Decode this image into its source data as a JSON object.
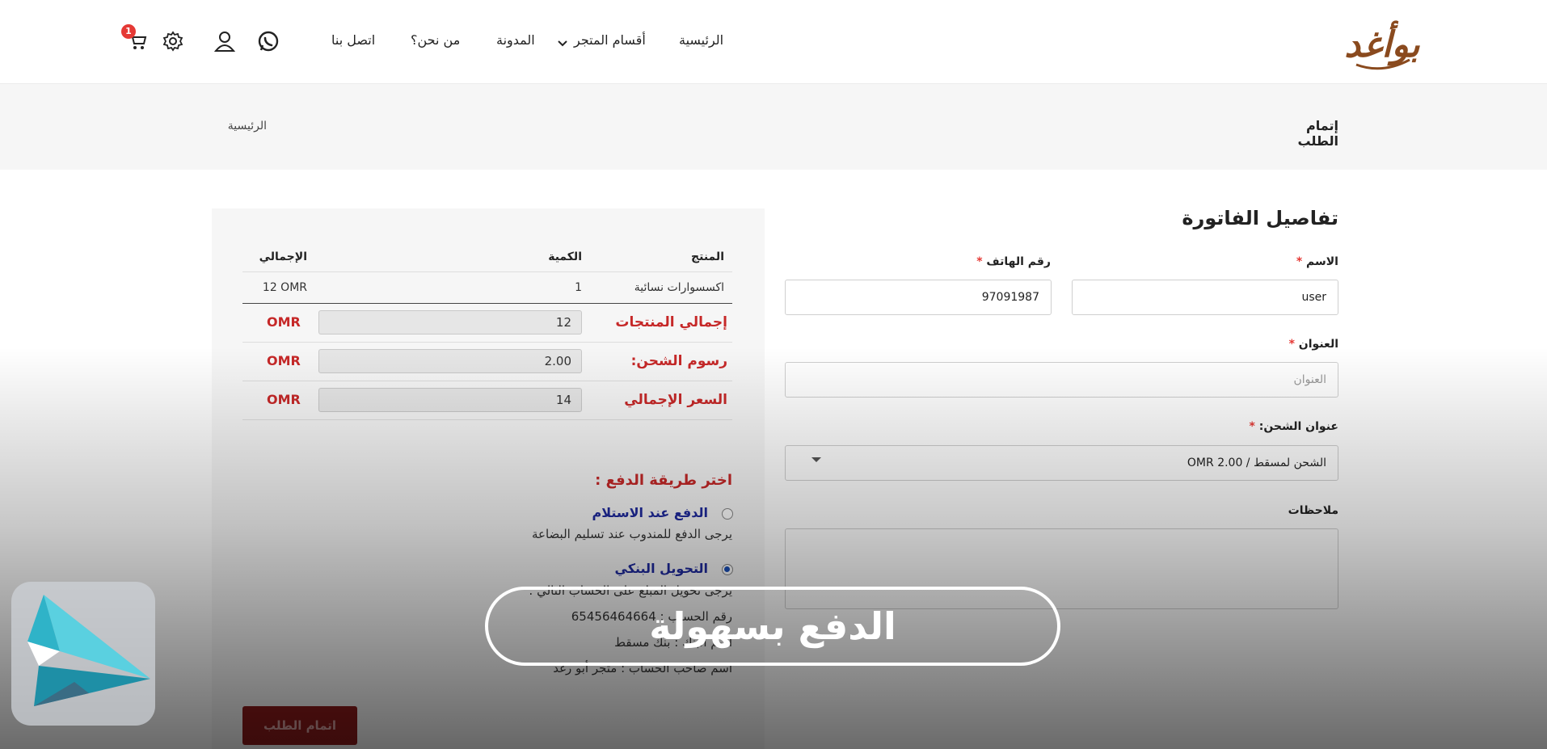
{
  "header": {
    "logo_text": "بوأغد",
    "nav": [
      {
        "label": "الرئيسية"
      },
      {
        "label": "أقسام المتجر"
      },
      {
        "label": "المدونة"
      },
      {
        "label": "من نحن؟"
      },
      {
        "label": "اتصل بنا"
      }
    ],
    "cart_count": "1",
    "icons": [
      "whatsapp-icon",
      "user-icon",
      "settings-icon",
      "cart-icon",
      "chevron-down-icon"
    ]
  },
  "breadcrumb": {
    "title": "إتمام الطلب",
    "home": "الرئيسية"
  },
  "billing": {
    "title": "تفاصيل الفاتورة",
    "name_label": "الاسم",
    "name_value": "user",
    "phone_label": "رقم الهاتف",
    "phone_value": "97091987",
    "address_label": "العنوان",
    "address_placeholder": "العنوان",
    "shipping_label": "عنوان الشحن:",
    "shipping_value": "الشحن لمسقط / 2.00 OMR",
    "notes_label": "ملاحظات",
    "required_mark": "*"
  },
  "order": {
    "headers": {
      "product": "المنتج",
      "qty": "الكمية",
      "total": "الإجمالي"
    },
    "rows": [
      {
        "product": "اكسسوارات نسائية",
        "qty": "1",
        "total": "12 OMR"
      }
    ],
    "subtotal_label": "إجمالي المنتجات",
    "subtotal_value": "12",
    "shipping_label": "رسوم الشحن:",
    "shipping_value": "2.00",
    "total_label": "السعر الإجمالي",
    "total_value": "14",
    "currency": "OMR"
  },
  "payment": {
    "title": "اختر طريقة الدفع :",
    "options": [
      {
        "label": "الدفع عند الاستلام",
        "desc": "يرجى الدفع للمندوب عند تسليم البضاعة",
        "selected": false
      },
      {
        "label": "التحويل البنكي",
        "selected": true
      }
    ],
    "bank_lines": [
      "يرجى تحويل المبلغ على الحساب التالي :",
      "رقم الحساب : 65456464664",
      "اسم البنك : بنك مسقط",
      "اسم صاحب الحساب : متجر أبو رغد"
    ],
    "place_order": "اتمام الطلب"
  },
  "overlay": {
    "caption": "الدفع بسهولة"
  }
}
